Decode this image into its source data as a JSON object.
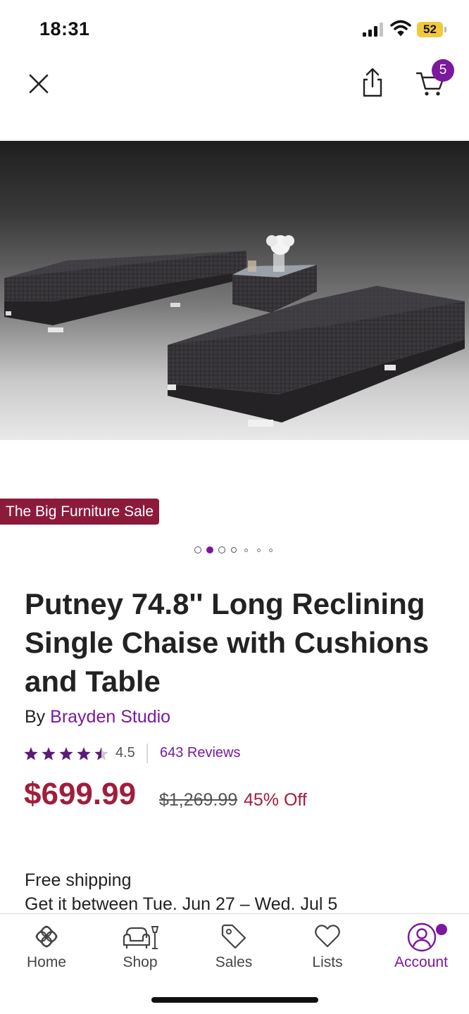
{
  "status_bar": {
    "time": "18:31",
    "battery_level": "52",
    "icons": [
      "signal-icon",
      "wifi-icon",
      "battery-icon"
    ]
  },
  "nav": {
    "icons": [
      "close-icon",
      "share-icon",
      "cart-icon"
    ],
    "cart_count": "5"
  },
  "gallery": {
    "image_count": 7,
    "active_index": 1,
    "badge": "The Big Furniture Sale"
  },
  "product": {
    "title": "Putney 74.8'' Long Reclining Single Chaise with Cushions and Table",
    "brand_prefix": "By",
    "brand": "Brayden Studio",
    "rating": "4.5",
    "rating_stars": 4.5,
    "reviews": "643 Reviews",
    "sale_price": "$699.99",
    "original_price": "$1,269.99",
    "discount": "45% Off",
    "shipping_label": "Free shipping",
    "delivery": "Get it between Tue. Jun 27 – Wed. Jul 5"
  },
  "tab_bar": {
    "tabs": [
      {
        "label": "Home",
        "icon": "home-icon"
      },
      {
        "label": "Shop",
        "icon": "shop-icon"
      },
      {
        "label": "Sales",
        "icon": "sales-tag-icon"
      },
      {
        "label": "Lists",
        "icon": "heart-icon"
      },
      {
        "label": "Account",
        "icon": "account-icon"
      }
    ],
    "active": "Account"
  },
  "colors": {
    "brand_purple": "#7b189f",
    "sale_red": "#a01e3c",
    "banner_red": "#8c1b3b"
  }
}
